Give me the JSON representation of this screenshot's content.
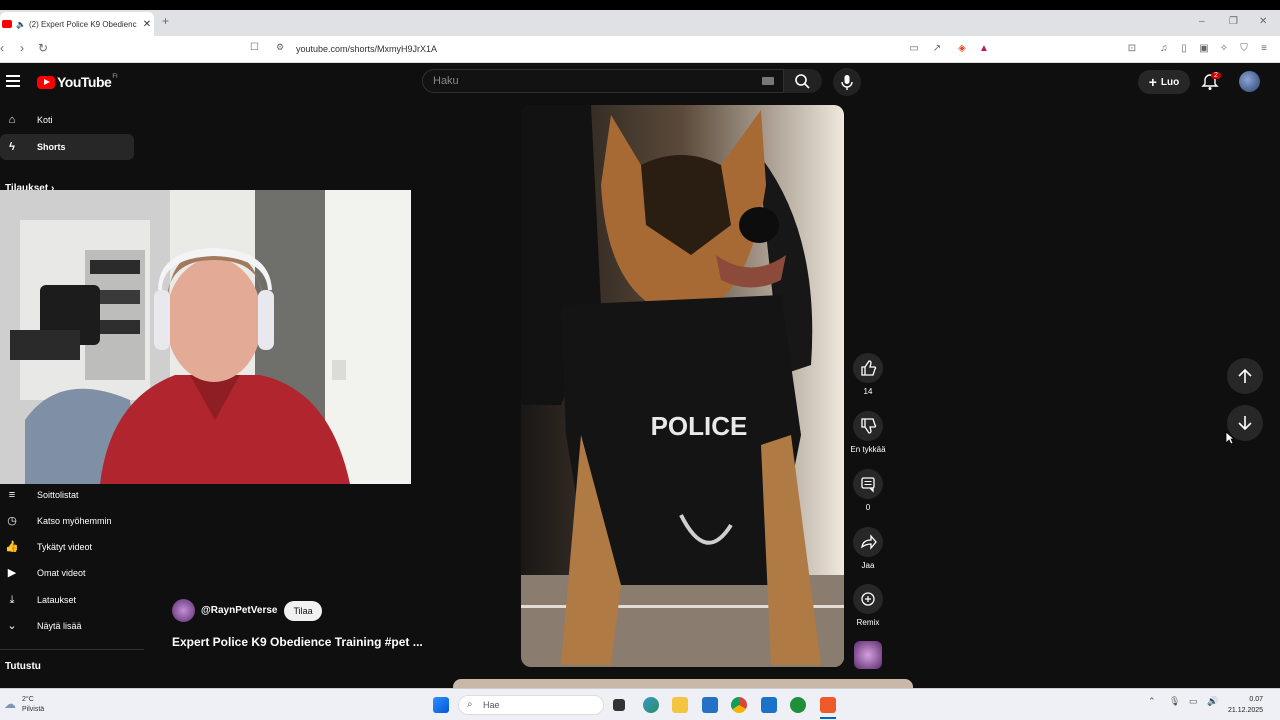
{
  "browser": {
    "tab_title": "(2) Expert Police K9 Obedienc",
    "url": "youtube.com/shorts/MxmyH9JrX1A"
  },
  "youtube": {
    "logo_text": "YouTube",
    "country": "FI",
    "search_placeholder": "Haku",
    "create_label": "Luo",
    "notification_count": "2",
    "sidebar": {
      "items_top": [
        {
          "label": "Koti",
          "icon": "home-icon"
        },
        {
          "label": "Shorts",
          "icon": "shorts-icon"
        }
      ],
      "subscriptions_heading": "Tilaukset",
      "items_you": [
        {
          "label": "Soittolistat",
          "icon": "playlist-icon"
        },
        {
          "label": "Katso myöhemmin",
          "icon": "clock-icon"
        },
        {
          "label": "Tykätyt videot",
          "icon": "thumbs-up-icon"
        },
        {
          "label": "Omat videot",
          "icon": "video-icon"
        },
        {
          "label": "Lataukset",
          "icon": "download-icon"
        },
        {
          "label": "Näytä lisää",
          "icon": "chevron-down-icon"
        }
      ],
      "explore_heading": "Tutustu"
    },
    "short": {
      "channel": "@RaynPetVerse",
      "subscribe_label": "Tilaa",
      "title": "Expert Police K9 Obedience Training  #pet ...",
      "vest_text": "POLICE"
    },
    "actions": {
      "like_count": "14",
      "dislike_label": "En tykkää",
      "comment_count": "0",
      "share_label": "Jaa",
      "remix_label": "Remix"
    }
  },
  "taskbar": {
    "weather_temp": "2°C",
    "weather_desc": "Pilvistä",
    "search_label": "Hae",
    "time": "0.07",
    "date": "21.12.2025"
  },
  "colors": {
    "youtube_red": "#ff0000",
    "background": "#0f0f0f",
    "surface": "#272727"
  }
}
